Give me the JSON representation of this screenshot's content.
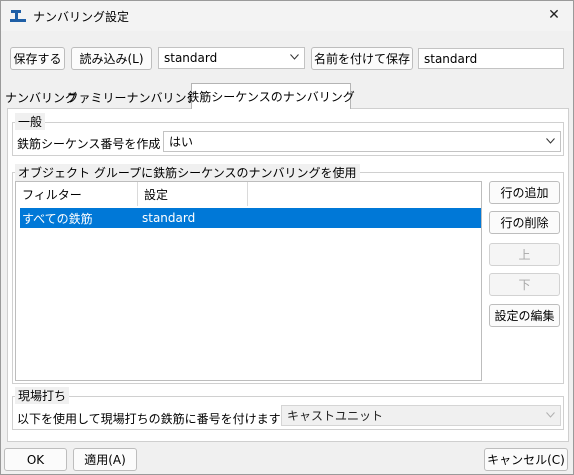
{
  "window": {
    "title": "ナンバリング設定",
    "close_label": "✕"
  },
  "toolbar": {
    "save_label": "保存する",
    "load_label": "読み込み(L)",
    "preset_value": "standard",
    "save_as_label": "名前を付けて保存",
    "save_as_value": "standard"
  },
  "tabs": [
    {
      "label": "ナンバリング"
    },
    {
      "label": "ファミリーナンバリング"
    },
    {
      "label": "鉄筋シーケンスのナンバリング"
    }
  ],
  "general": {
    "legend": "一般",
    "create_label": "鉄筋シーケンス番号を作成",
    "create_value": "はい"
  },
  "object_group": {
    "legend": "オブジェクト グループに鉄筋シーケンスのナンバリングを使用",
    "columns": [
      "フィルター",
      "設定"
    ],
    "rows": [
      {
        "filter": "すべての鉄筋",
        "setting": "standard"
      }
    ],
    "add_row_label": "行の追加",
    "delete_row_label": "行の削除",
    "up_label": "上",
    "down_label": "下",
    "edit_label": "設定の編集"
  },
  "cast_in_place": {
    "legend": "現場打ち",
    "label": "以下を使用して現場打ちの鉄筋に番号を付けます",
    "value": "キャストユニット"
  },
  "footer": {
    "ok_label": "OK",
    "apply_label": "適用(A)",
    "cancel_label": "キャンセル(C)"
  }
}
